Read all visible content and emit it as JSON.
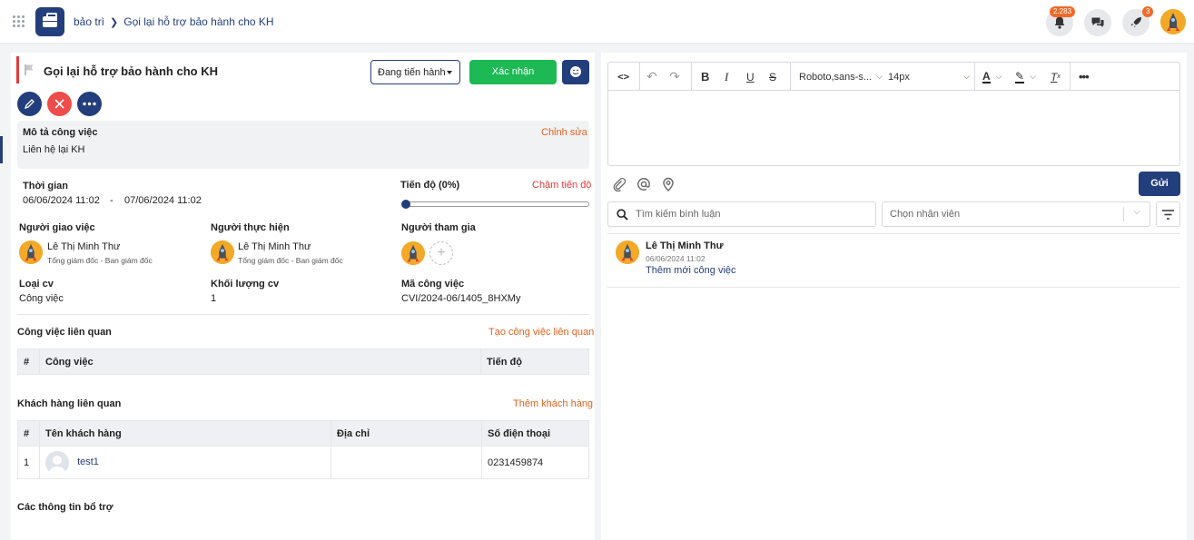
{
  "header": {
    "breadcrumb_root": "bảo trì",
    "breadcrumb_current": "Gọi lại hỗ trợ bảo hành cho KH",
    "notifications_count": "2.283",
    "rocket_count": "3"
  },
  "task": {
    "title": "Gọi lại hỗ trợ bảo hành cho KH",
    "status": "Đang tiến hành",
    "confirm_label": "Xác nhận",
    "description_label": "Mô tả công việc",
    "edit_label": "Chỉnh sửa",
    "description": "Liên hệ lại KH",
    "time_label": "Thời gian",
    "start_time": "06/06/2024 11:02",
    "time_sep": "-",
    "end_time": "07/06/2024 11:02",
    "progress_label": "Tiến độ (0%)",
    "progress_value": 0,
    "progress_status": "Chậm tiến độ",
    "assigner_label": "Người giao việc",
    "assigner_name": "Lê Thị Minh Thư",
    "assigner_role": "Tổng giám đốc - Ban giám đốc",
    "executor_label": "Người thực hiện",
    "executor_name": "Lê Thị Minh Thư",
    "executor_role": "Tổng giám đốc - Ban giám đốc",
    "participants_label": "Người tham gia",
    "type_label": "Loại cv",
    "type_value": "Công việc",
    "volume_label": "Khối lượng cv",
    "volume_value": "1",
    "code_label": "Mã công việc",
    "code_value": "CVI/2024-06/1405_8HXMy"
  },
  "related_tasks": {
    "title": "Công việc liên quan",
    "create_label": "Tạo công việc liên quan",
    "columns": [
      "#",
      "Công việc",
      "Tiến độ"
    ]
  },
  "related_customers": {
    "title": "Khách hàng liên quan",
    "add_label": "Thêm khách hàng",
    "columns": [
      "#",
      "Tên khách hàng",
      "Địa chỉ",
      "Số điện thoại"
    ],
    "rows": [
      {
        "index": "1",
        "name": "test1",
        "address": "",
        "phone": "0231459874"
      }
    ]
  },
  "extra_info_title": "Các thông tin bổ trợ",
  "editor": {
    "font_family": "Roboto,sans-s...",
    "font_size": "14px",
    "send_label": "Gửi"
  },
  "comments": {
    "search_placeholder": "Tìm kiếm bình luận",
    "employee_placeholder": "Chọn nhân viên",
    "items": [
      {
        "author": "Lê Thị Minh Thư",
        "time": "06/06/2024 11:02",
        "text": "Thêm mới công việc"
      }
    ]
  },
  "colors": {
    "primary": "#233e7c",
    "confirm": "#1cb954",
    "danger": "#e23b3b",
    "accent_link": "#e0621f"
  }
}
